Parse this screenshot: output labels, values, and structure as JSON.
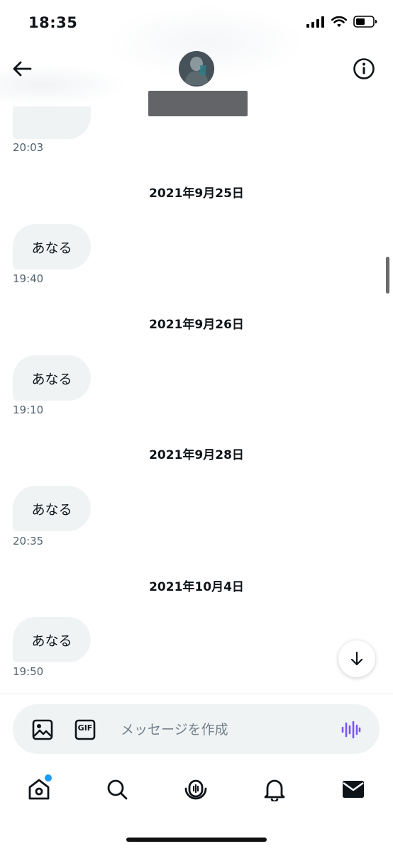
{
  "status_bar": {
    "time": "18:35"
  },
  "messages": [
    {
      "time": "20:03"
    },
    {
      "date": "2021年9月25日",
      "text": "あなる",
      "time": "19:40"
    },
    {
      "date": "2021年9月26日",
      "text": "あなる",
      "time": "19:10"
    },
    {
      "date": "2021年9月28日",
      "text": "あなる",
      "time": "20:35"
    },
    {
      "date": "2021年10月4日",
      "text": "あなる",
      "time": "19:50"
    }
  ],
  "composer": {
    "placeholder": "メッセージを作成",
    "gif_label": "GIF"
  },
  "colors": {
    "accent": "#1d9bf0",
    "voice": "#7856ff",
    "bubble": "#eff3f4",
    "time_text": "#536471"
  },
  "icons": [
    "back-arrow-icon",
    "info-icon",
    "image-icon",
    "gif-icon",
    "voice-icon",
    "arrow-down-icon",
    "home-icon",
    "search-icon",
    "spaces-icon",
    "bell-icon",
    "mail-icon"
  ]
}
